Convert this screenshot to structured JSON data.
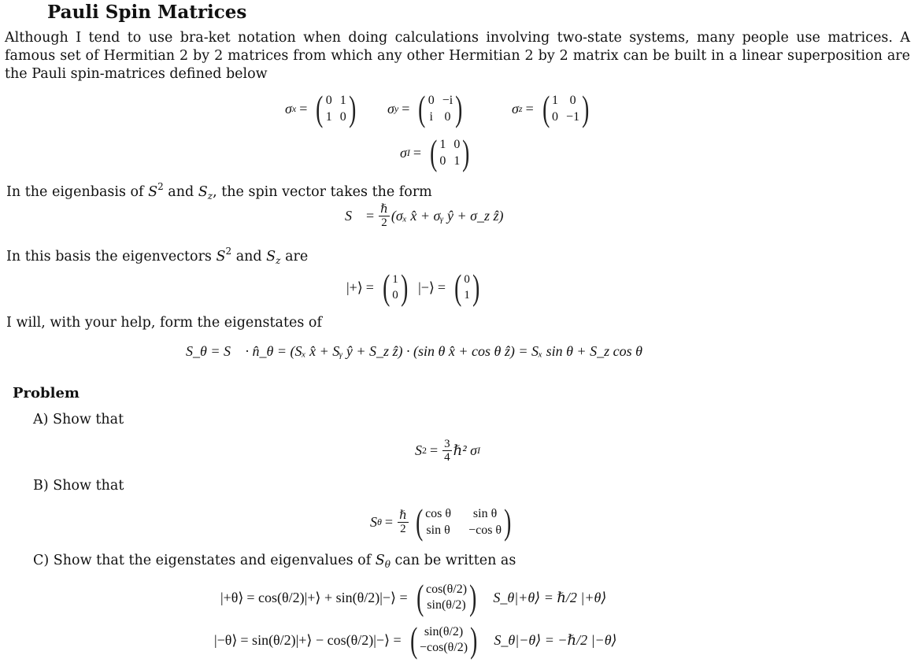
{
  "title": "Pauli Spin Matrices",
  "intro": "Although I tend to use bra-ket notation when doing calculations involving two-state systems, many people use matrices. A famous set of Hermitian 2 by 2 matrices from which any other Hermitian 2 by 2 matrix can be built in a linear superposition are the Pauli spin-matrices defined below",
  "pauli": {
    "sx_label": "σ",
    "sx_sub": "x",
    "sx": [
      "0",
      "1",
      "1",
      "0"
    ],
    "sy_label": "σ",
    "sy_sub": "y",
    "sy": [
      "0",
      "−i",
      "i",
      "0"
    ],
    "sz_label": "σ",
    "sz_sub": "z",
    "sz": [
      "1",
      "0",
      "0",
      "−1"
    ],
    "sI_label": "σ",
    "sI_sub": "I",
    "sI": [
      "1",
      "0",
      "0",
      "1"
    ]
  },
  "eigenbasis_text": "In the eigenbasis of S² and S_z, the spin vector takes the form",
  "eigenbasis": {
    "pre": "In the eigenbasis of ",
    "S": "S",
    "sq": "2",
    "and": " and ",
    "Sz": "S",
    "z": "z",
    "post": ", the spin vector takes the form"
  },
  "spin_vector": {
    "lhs": "S⃗",
    "num": "ℏ",
    "den": "2",
    "rhs": "(σₓ x̂ + σᵧ ŷ + σ_z ẑ)"
  },
  "basis_text": {
    "pre": "In this basis the eigenvectors ",
    "S": "S",
    "sq": "2",
    "and": " and ",
    "Sz": "S",
    "z": "z",
    "post": " are"
  },
  "kets": {
    "plus": "|+⟩",
    "plus_vec": [
      "1",
      "0"
    ],
    "minus": "|−⟩",
    "minus_vec": [
      "0",
      "1"
    ]
  },
  "form_text": "I will, with your help, form the eigenstates of",
  "s_theta_eq": "S_θ = S⃗ · n̂_θ = (Sₓ x̂ + Sᵧ ŷ + S_z ẑ) · (sin θ x̂ + cos θ ẑ) = Sₓ sin θ + S_z cos θ",
  "problem": {
    "heading": "Problem",
    "a_label": "A) Show that",
    "a_eq": {
      "lhs": "S",
      "sq": "2",
      "num": "3",
      "den": "4",
      "rhs": "ℏ² σ",
      "sub": "I"
    },
    "b_label": "B) Show that",
    "b_eq": {
      "lhs": "S",
      "sub": "θ",
      "num": "ℏ",
      "den": "2",
      "matrix": [
        "cos θ",
        "sin θ",
        "sin θ",
        "−cos θ"
      ]
    },
    "c_label": "C) Show that the eigenstates and eigenvalues of S_θ can be written as",
    "c_label_pre": "C) Show that the eigenstates and eigenvalues of ",
    "c_label_post": " can be written as",
    "c_rows": [
      {
        "ket": "|+θ⟩",
        "expr": "= cos(θ/2)|+⟩ + sin(θ/2)|−⟩ =",
        "vec": [
          "cos(θ/2)",
          "sin(θ/2)"
        ],
        "eig": "S_θ|+θ⟩ = ℏ/2 |+θ⟩"
      },
      {
        "ket": "|−θ⟩",
        "expr": "= sin(θ/2)|+⟩ − cos(θ/2)|−⟩ =",
        "vec": [
          "sin(θ/2)",
          "−cos(θ/2)"
        ],
        "eig": "S_θ|−θ⟩ = −ℏ/2 |−θ⟩"
      }
    ]
  }
}
